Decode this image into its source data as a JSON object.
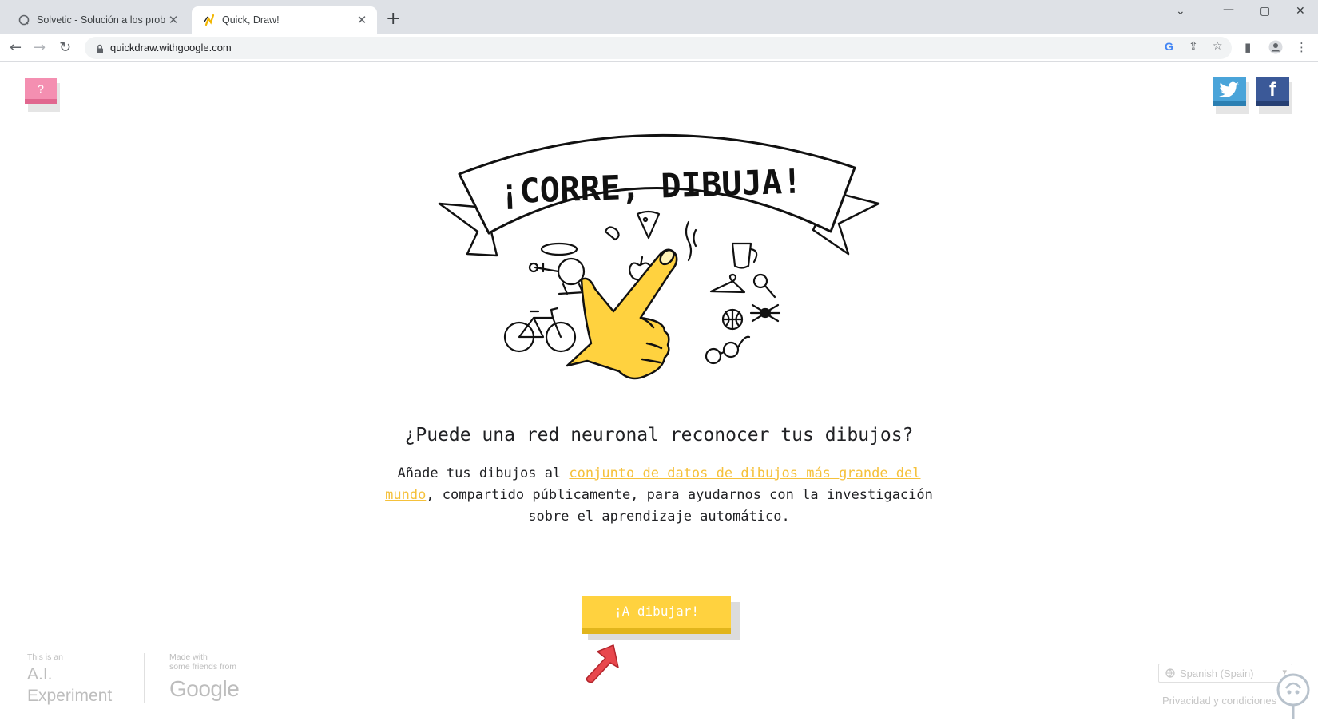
{
  "browser": {
    "tabs": [
      {
        "title": "Solvetic - Solución a los problem",
        "active": false
      },
      {
        "title": "Quick, Draw!",
        "active": true
      }
    ],
    "new_tab_symbol": "+",
    "url": "quickdraw.withgoogle.com"
  },
  "page": {
    "help_label": "?",
    "twitter_label": "t",
    "facebook_label": "f",
    "hero_banner_text": "¡CORRE, DIBUJA!",
    "headline": "¿Puede una red neuronal reconocer tus dibujos?",
    "description": {
      "before_link": "Añade tus dibujos al ",
      "link": "conjunto de datos de dibujos más grande del mundo",
      "after_link": ", compartido públicamente, para ayudarnos con la investigación sobre el aprendizaje automático."
    },
    "cta_label": "¡A dibujar!",
    "footer": {
      "ai_small": "This is an",
      "ai_line1": "A.I.",
      "ai_line2": "Experiment",
      "made_line1": "Made with",
      "made_line2": "some friends from",
      "google": "Google",
      "language": "Spanish (Spain)",
      "privacy": "Privacidad y condiciones"
    }
  },
  "colors": {
    "accent_yellow": "#ffd23f",
    "link_yellow": "#f5c13b",
    "help_pink": "#f48fb1",
    "twitter_blue": "#4aa4d9",
    "facebook_blue": "#3b5998",
    "annotation_arrow": "#e8474d"
  }
}
